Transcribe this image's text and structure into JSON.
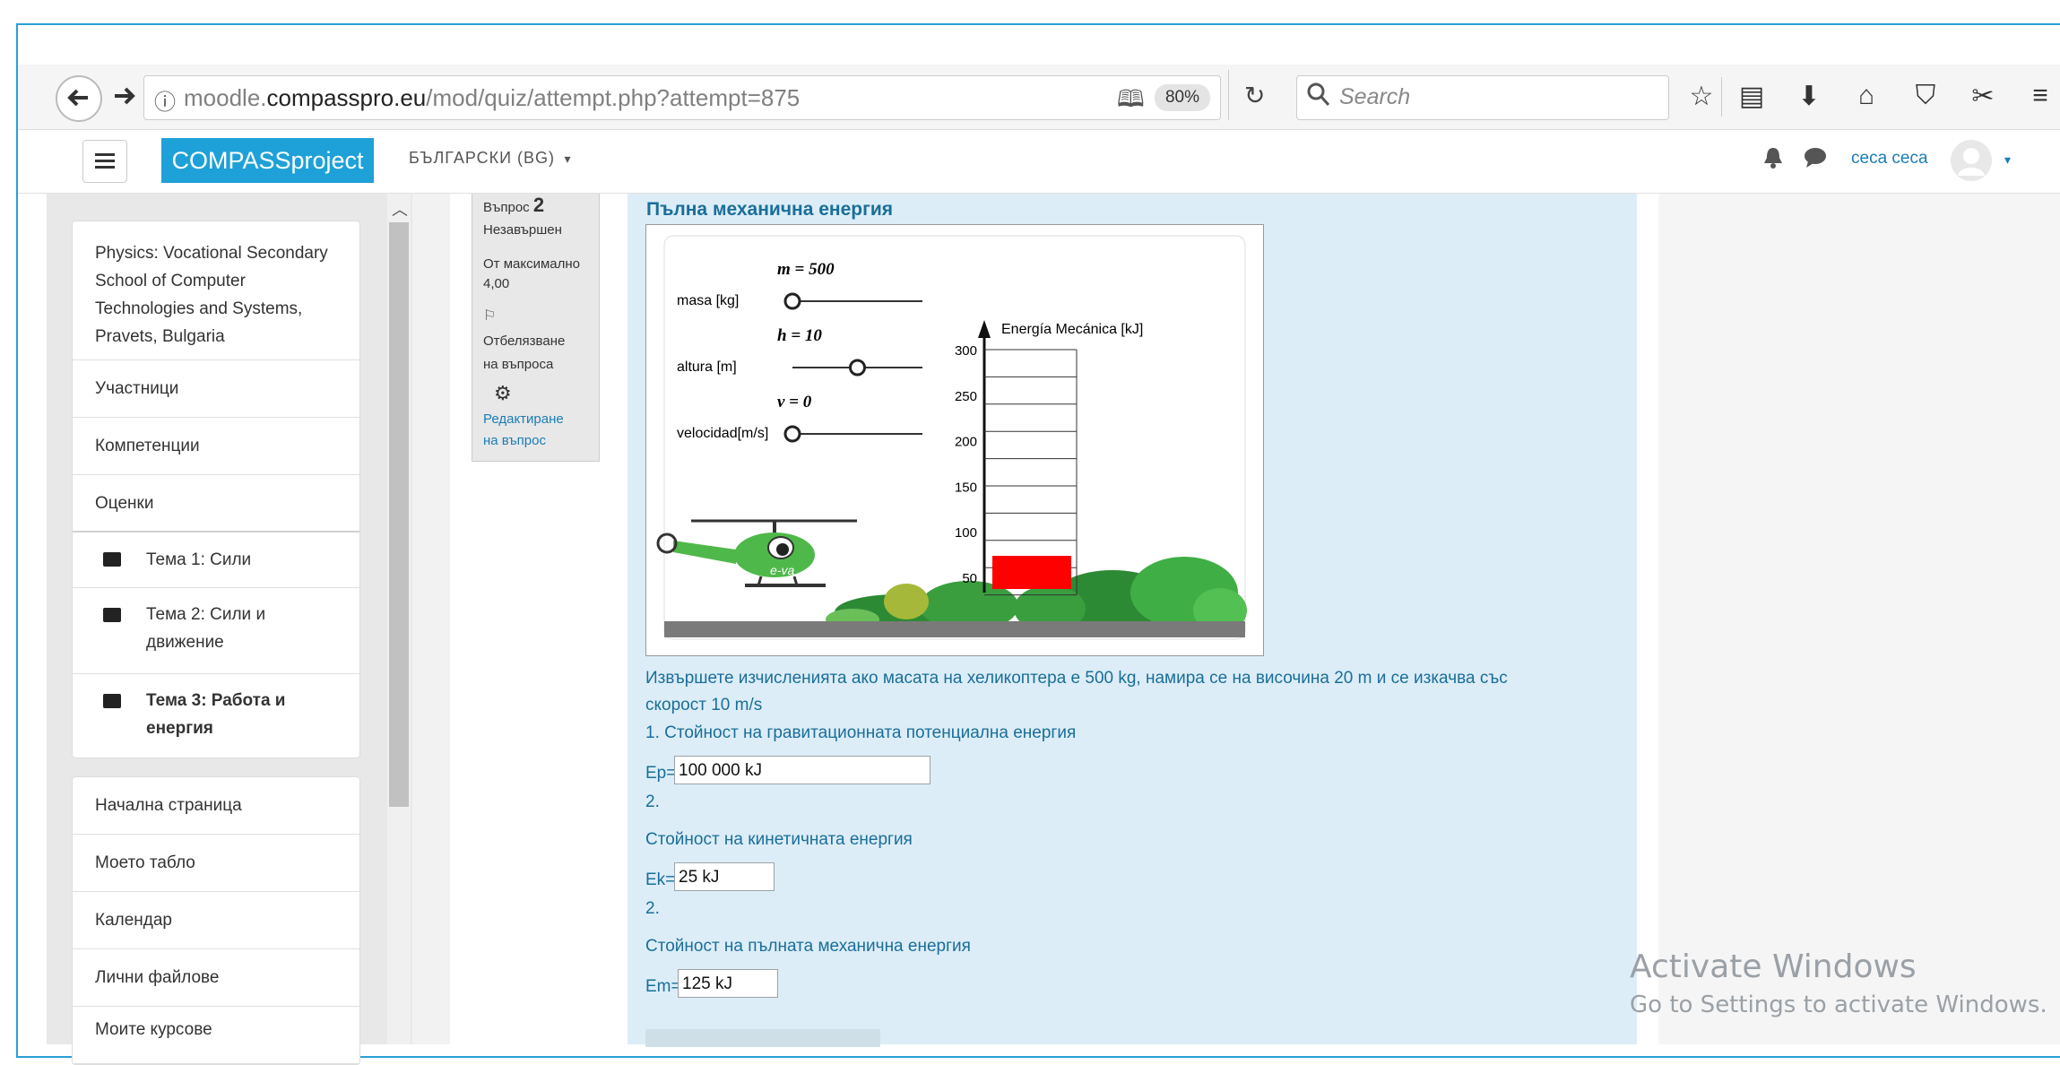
{
  "browser": {
    "url_prefix": "moodle.",
    "url_domain": "compasspro.eu",
    "url_path": "/mod/quiz/attempt.php?attempt=875",
    "zoom": "80%",
    "search_placeholder": "Search"
  },
  "header": {
    "brand": "COMPASSproject",
    "language": "БЪЛГАРСКИ (BG)",
    "username": "сеса сеса"
  },
  "sidebar": {
    "course_title": "Physics: Vocational Secondary School of Computer Technologies and Systems, Pravets, Bulgaria",
    "items": [
      "Участници",
      "Компетенции",
      "Оценки"
    ],
    "topics": [
      "Тема 1: Сили",
      "Тема 2: Сили и движение",
      "Тема 3: Работа и енергия"
    ],
    "nav": [
      "Начална страница",
      "Моето табло",
      "Календар",
      "Лични файлове",
      "Моите курсове"
    ]
  },
  "question_info": {
    "number_label": "Въпрос",
    "number": "2",
    "state": "Незавършен",
    "max_label": "От максимално 4,00",
    "flag_label": "Отбелязване на въпроса",
    "edit_label": "Редактиране на въпрос"
  },
  "question": {
    "title": "Пълна механична енергия",
    "text_line1": "Извършете изчисленията ако масата на хеликоптера е 500 kg, намира се на височина 20 m и се изкачва със",
    "text_line2": "скорост 10 m/s",
    "item1": "1. Стойност на гравитационната потенциална енергия",
    "ep_label": "Ep=",
    "ep_value": "100 000 kJ",
    "num2a": "2.",
    "item2": "Стойност на кинетичната енергия",
    "ek_label": "Ek=",
    "ek_value": "25 kJ",
    "num2b": "2.",
    "item3": "Стойност на пълната механична енергия",
    "em_label": "Em=",
    "em_value": "125 kJ"
  },
  "applet": {
    "m_label": "m = 500",
    "m_caption": "masa [kg]",
    "m_slider": 0,
    "h_label": "h = 10",
    "h_caption": "altura [m]",
    "h_slider": 0.5,
    "v_label": "v = 0",
    "v_caption": "velocidad[m/s]",
    "v_slider": 0,
    "chart_title": "Energía Mecánica [kJ]",
    "y_ticks": [
      "300",
      "250",
      "200",
      "150",
      "100",
      "50"
    ],
    "energy_value": 50,
    "bar_color": "#ff0000",
    "heli_label": "e-va"
  },
  "watermark": {
    "line1": "Activate Windows",
    "line2": "Go to Settings to activate Windows."
  }
}
